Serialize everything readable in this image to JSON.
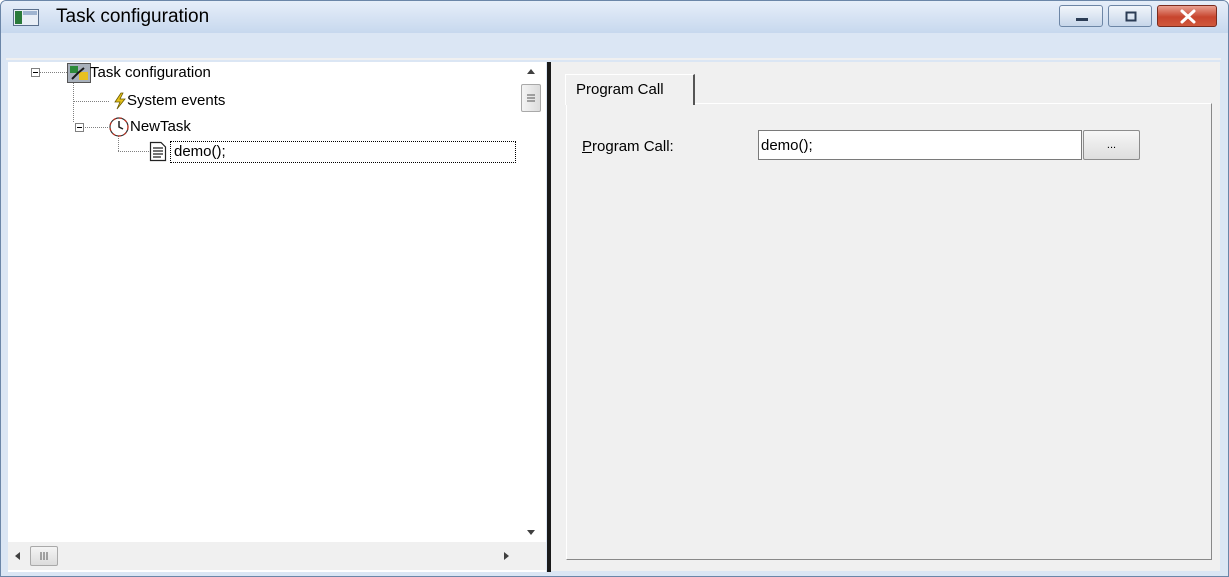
{
  "window": {
    "title": "Task configuration",
    "controls": [
      "minimize",
      "maximize",
      "close"
    ]
  },
  "tree": {
    "nodes": [
      {
        "label": "Task configuration",
        "icon": "task-configuration-icon",
        "expanded": true
      },
      {
        "label": "System events",
        "icon": "lightning-icon"
      },
      {
        "label": "NewTask",
        "icon": "clock-icon",
        "expanded": true
      },
      {
        "label": "demo();",
        "icon": "document-icon",
        "selected": true
      }
    ]
  },
  "tabs": [
    {
      "label": "Program Call",
      "active": true
    }
  ],
  "form": {
    "program_call_label": "Program Call:",
    "program_call_value": "demo();",
    "browse_label": "..."
  },
  "colors": {
    "title_bar": "#c7d8ee",
    "close_button": "#c7452e",
    "panel_background": "#f0f0f0"
  }
}
